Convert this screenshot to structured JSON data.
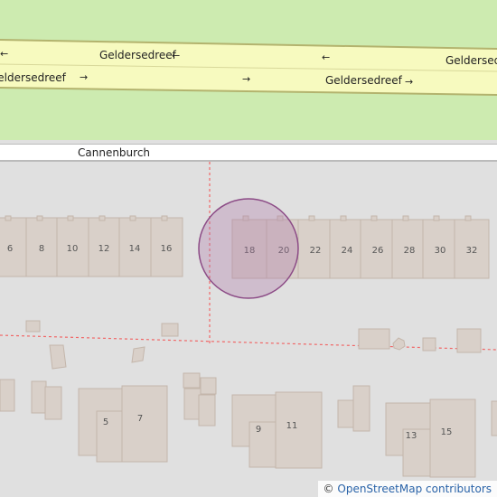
{
  "map": {
    "roads": {
      "main": "Geldersedreef",
      "side": "Cannenburch"
    },
    "house_numbers_north": [
      "6",
      "8",
      "10",
      "12",
      "14",
      "16",
      "18",
      "20",
      "22",
      "24",
      "26",
      "28",
      "30",
      "32"
    ],
    "house_numbers_south": [
      "5",
      "7",
      "9",
      "11",
      "13",
      "15"
    ],
    "colors": {
      "grass": "#cdebb0",
      "road_fill": "#f7fabf",
      "road_casing": "#b3b36e",
      "land": "#e0e0e0",
      "building_fill": "#d9d0c9",
      "building_stroke": "#c4b6ab",
      "boundary": "#f06767",
      "marker_fill": "#b07aa8",
      "marker_stroke": "#8c4b86"
    },
    "marker_icon": "location-circle"
  },
  "attribution": {
    "copyright_symbol": "©",
    "text": "OpenStreetMap contributors"
  }
}
